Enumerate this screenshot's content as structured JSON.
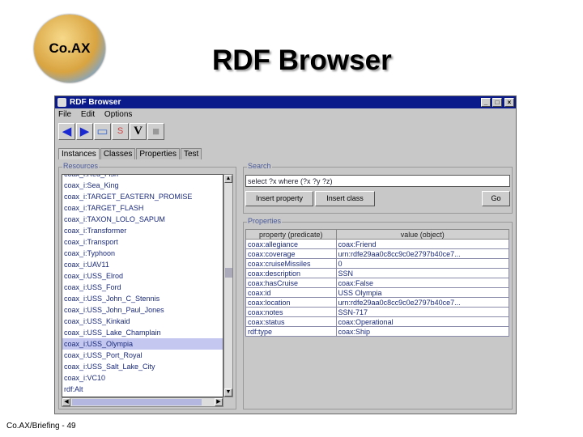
{
  "slide": {
    "logo_text": "Co.AX",
    "title": "RDF Browser",
    "footer": "Co.AX/Briefing - 49"
  },
  "window": {
    "title": "RDF Browser",
    "menu": [
      "File",
      "Edit",
      "Options"
    ],
    "toolbar_icons": [
      "back-arrow-icon",
      "forward-arrow-icon",
      "open-folder-icon",
      "query-icon",
      "validate-icon",
      "save-icon"
    ],
    "tabs": [
      "Instances",
      "Classes",
      "Properties",
      "Test"
    ],
    "active_tab": "Instances"
  },
  "resources": {
    "label": "Resources",
    "items": [
      "coax_i:Red_Fish",
      "coax_i:Sea_King",
      "coax_i:TARGET_EASTERN_PROMISE",
      "coax_i:TARGET_FLASH",
      "coax_i:TAXON_LOLO_SAPUM",
      "coax_i:Transformer",
      "coax_i:Transport",
      "coax_i:Typhoon",
      "coax_i:UAV11",
      "coax_i:USS_Elrod",
      "coax_i:USS_Ford",
      "coax_i:USS_John_C_Stennis",
      "coax_i:USS_John_Paul_Jones",
      "coax_i:USS_Kinkaid",
      "coax_i:USS_Lake_Champlain",
      "coax_i:USS_Olympia",
      "coax_i:USS_Port_Royal",
      "coax_i:USS_Salt_Lake_City",
      "coax_i:VC10",
      "rdf:Alt"
    ],
    "selected": "coax_i:USS_Olympia"
  },
  "search": {
    "label": "Search",
    "query": "select ?x where (?x ?y ?z)",
    "insert_property": "Insert property",
    "insert_class": "Insert class",
    "go": "Go"
  },
  "properties": {
    "label": "Properties",
    "columns": [
      "property (predicate)",
      "value (object)"
    ],
    "rows": [
      [
        "coax:allegiance",
        "coax:Friend"
      ],
      [
        "coax:coverage",
        "urn:rdfe29aa0c8cc9c0e2797b40ce7..."
      ],
      [
        "coax:cruiseMissiles",
        "0"
      ],
      [
        "coax:description",
        "SSN"
      ],
      [
        "coax:hasCruise",
        "coax:False"
      ],
      [
        "coax:id",
        "USS Olympia"
      ],
      [
        "coax:location",
        "urn:rdfe29aa0c8cc9c0e2797b40ce7..."
      ],
      [
        "coax:notes",
        "SSN-717"
      ],
      [
        "coax:status",
        "coax:Operational"
      ],
      [
        "rdf:type",
        "coax:Ship"
      ]
    ]
  }
}
